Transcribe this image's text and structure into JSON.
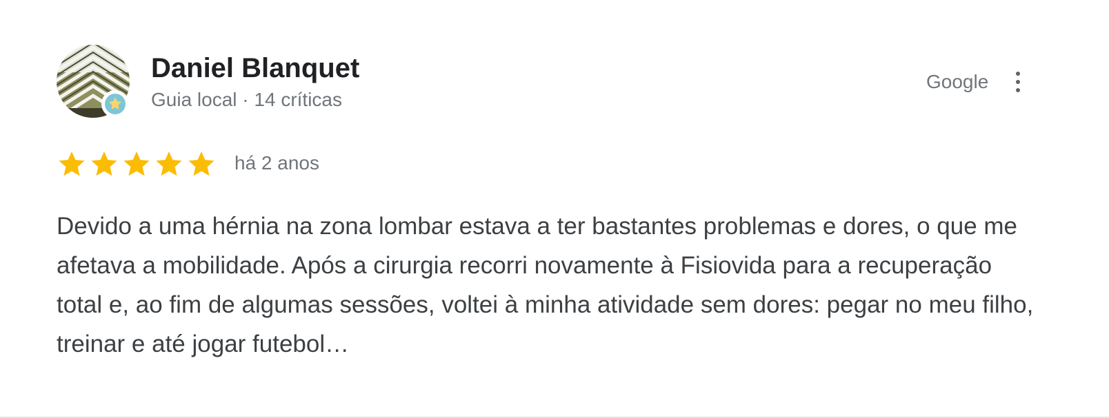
{
  "review": {
    "reviewer_name": "Daniel Blanquet",
    "reviewer_meta": "Guia local · 14 críticas",
    "source": "Google",
    "rating": 5,
    "rating_max": 5,
    "time_ago": "há 2 anos",
    "text": "Devido a uma hérnia na zona lombar estava a ter bastantes problemas e dores, o que me afetava a mobilidade. Após a cirurgia recorri novamente à Fisiovida para a recuperação total e, ao fim de algumas sessões, voltei à minha atividade sem dores: pegar no meu filho, treinar e até jogar futebol…"
  },
  "icons": {
    "more": "more-vert-icon",
    "star": "star-icon",
    "badge": "local-guide-badge-icon"
  },
  "colors": {
    "star": "#fbbc04",
    "name": "#202124",
    "secondary": "#70757a",
    "body": "#3c4043"
  }
}
